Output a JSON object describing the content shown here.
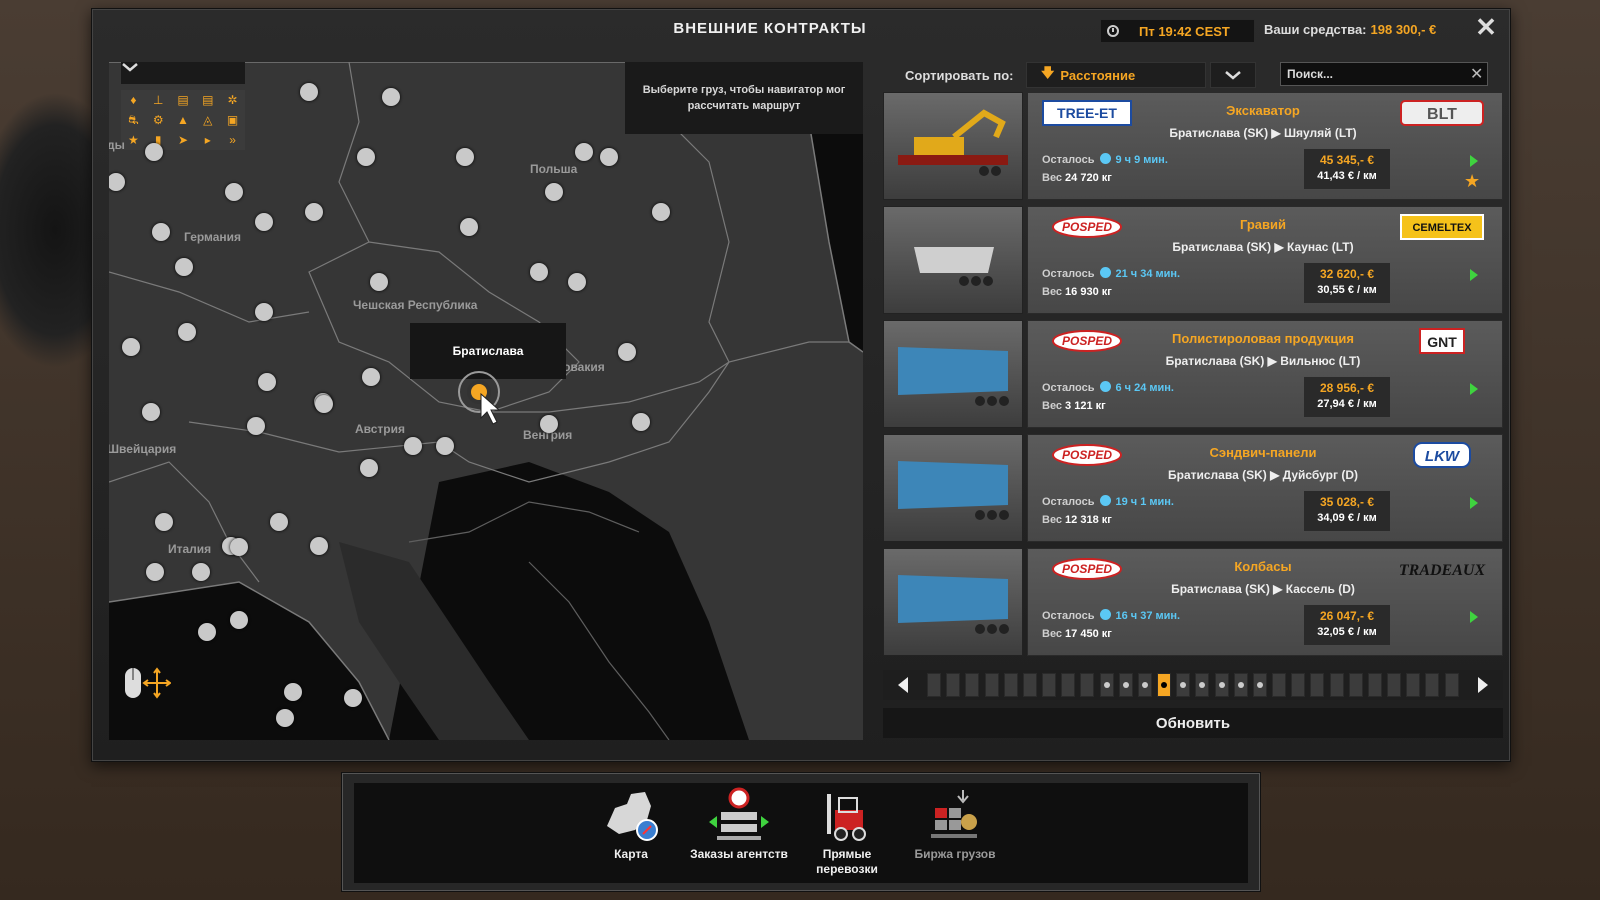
{
  "header": {
    "title": "ВНЕШНИЕ КОНТРАКТЫ",
    "time": "Пт 19:42 CEST",
    "funds_label": "Ваши средства:",
    "funds_value": "198 300,- €",
    "close": "✕"
  },
  "map": {
    "hint": "Выберите груз, чтобы навигатор мог рассчитать маршрут",
    "selected_city": "Братислава",
    "labels": [
      {
        "text": "Польша"
      },
      {
        "text": "Германия"
      },
      {
        "text": "Чешская Республика"
      },
      {
        "text": "Словакия"
      },
      {
        "text": "Австрия"
      },
      {
        "text": "Венгрия"
      },
      {
        "text": "Швейцария"
      },
      {
        "text": "Италия"
      }
    ],
    "filter_partial_label": "ды"
  },
  "sort": {
    "label": "Сортировать по:",
    "selected": "Расстояние",
    "search_placeholder": "Поиск..."
  },
  "jobs": [
    {
      "sender": "TREE-ET",
      "receiver": "BLT",
      "cargo": "Экскаватор",
      "route": "Братислава (SK)  ▶  Шяуляй (LT)",
      "remaining_label": "Осталось",
      "remaining": "9 ч 9 мин.",
      "weight_label": "Вес",
      "weight": "24 720 кг",
      "price": "45 345,- €",
      "per_km": "41,43 € / км",
      "starred": true
    },
    {
      "sender": "POSPED",
      "receiver": "CEMELTEX",
      "cargo": "Гравий",
      "route": "Братислава (SK)  ▶  Каунас (LT)",
      "remaining_label": "Осталось",
      "remaining": "21 ч 34 мин.",
      "weight_label": "Вес",
      "weight": "16 930 кг",
      "price": "32 620,- €",
      "per_km": "30,55 € / км",
      "starred": false
    },
    {
      "sender": "POSPED",
      "receiver": "GNT",
      "cargo": "Полистироловая продукция",
      "route": "Братислава (SK)  ▶  Вильнюс (LT)",
      "remaining_label": "Осталось",
      "remaining": "6 ч 24 мин.",
      "weight_label": "Вес",
      "weight": "3 121 кг",
      "price": "28 956,- €",
      "per_km": "27,94 € / км",
      "starred": false
    },
    {
      "sender": "POSPED",
      "receiver": "LKW",
      "cargo": "Сэндвич-панели",
      "route": "Братислава (SK)  ▶  Дуйсбург (D)",
      "remaining_label": "Осталось",
      "remaining": "19 ч 1 мин.",
      "weight_label": "Вес",
      "weight": "12 318 кг",
      "price": "35 028,- €",
      "per_km": "34,09 € / км",
      "starred": false
    },
    {
      "sender": "POSPED",
      "receiver": "TRADEAUX",
      "cargo": "Колбасы",
      "route": "Братислава (SK)  ▶  Кассель (D)",
      "remaining_label": "Осталось",
      "remaining": "16 ч 37 мин.",
      "weight_label": "Вес",
      "weight": "17 450 кг",
      "price": "26 047,- €",
      "per_km": "32,05 € / км",
      "starred": false
    }
  ],
  "pager": {
    "total": 28,
    "lit_from": 9,
    "lit_to": 17,
    "current": 12
  },
  "refresh_label": "Обновить",
  "nav": [
    {
      "label": "Карта",
      "active": true
    },
    {
      "label": "Заказы агентств",
      "active": true
    },
    {
      "label": "Прямые перевозки",
      "active": true
    },
    {
      "label": "Биржа грузов",
      "active": false
    }
  ],
  "colors": {
    "accent": "#f5a623",
    "time_blue": "#5bc8f5",
    "go_green": "#3fd33f"
  }
}
